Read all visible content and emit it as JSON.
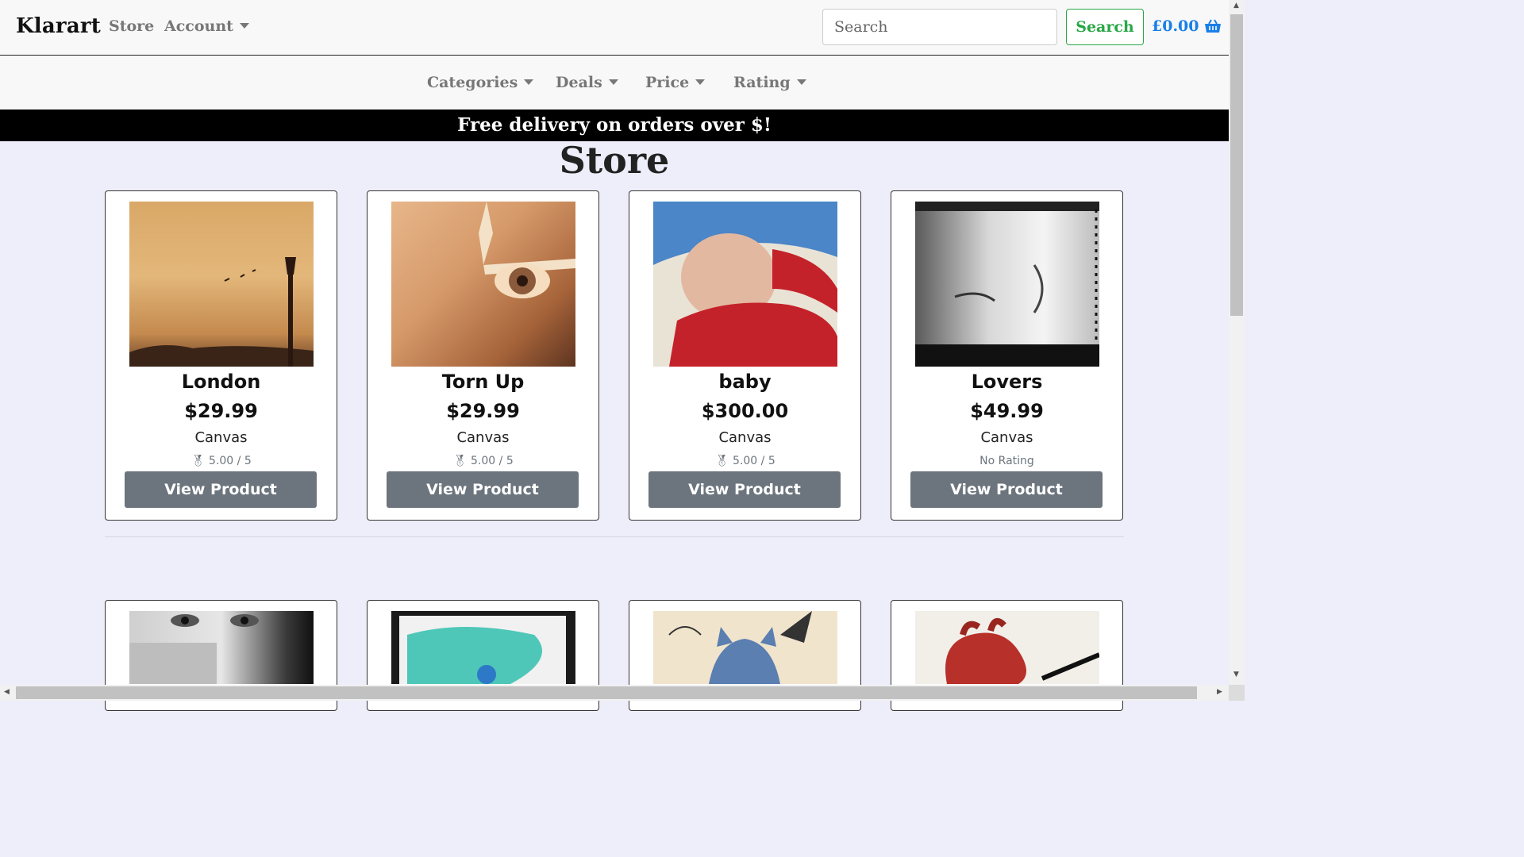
{
  "header": {
    "brand": "Klarart",
    "nav": {
      "store": "Store",
      "account": "Account"
    },
    "search": {
      "placeholder": "Search",
      "button": "Search"
    },
    "cart_total": "£0.00"
  },
  "subnav": {
    "categories": "Categories",
    "deals": "Deals",
    "price": "Price",
    "rating": "Rating"
  },
  "banner": "Free delivery on orders over $!",
  "page_title": "Store",
  "products": [
    {
      "name": "London",
      "price": "$29.99",
      "type": "Canvas",
      "rating": "5.00 / 5",
      "rated": true,
      "button": "View Product"
    },
    {
      "name": "Torn Up",
      "price": "$29.99",
      "type": "Canvas",
      "rating": "5.00 / 5",
      "rated": true,
      "button": "View Product"
    },
    {
      "name": "baby",
      "price": "$300.00",
      "type": "Canvas",
      "rating": "5.00 / 5",
      "rated": true,
      "button": "View Product"
    },
    {
      "name": "Lovers",
      "price": "$49.99",
      "type": "Canvas",
      "rating": "No Rating",
      "rated": false,
      "button": "View Product"
    }
  ],
  "colors": {
    "accent_green": "#28a745",
    "cart_blue": "#1a7fe8",
    "button_gray": "#6c757d",
    "page_bg": "#eeedfa"
  },
  "icons": {
    "cart": "basket-icon",
    "rating": "medal-icon",
    "dropdown": "caret-down-icon"
  }
}
